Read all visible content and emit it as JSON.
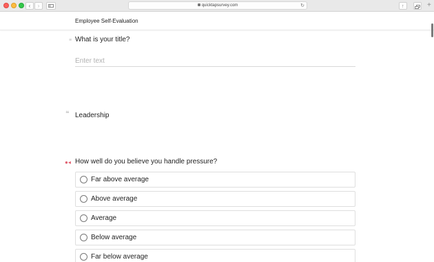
{
  "browser": {
    "url": "quicktapsurvey.com"
  },
  "survey": {
    "title": "Employee Self-Evaluation"
  },
  "questions": [
    {
      "label": "What is your title?",
      "placeholder": "Enter text",
      "value": ""
    },
    {
      "label": "Leadership"
    },
    {
      "label": "How well do you believe you handle pressure?",
      "options": [
        "Far above average",
        "Above average",
        "Average",
        "Below average",
        "Far below average"
      ]
    }
  ],
  "icons": {
    "back": "chevron-left-icon",
    "forward": "chevron-right-icon",
    "sidebar": "sidebar-icon",
    "lock": "lock-icon",
    "reload": "reload-icon",
    "share": "share-icon",
    "tabs": "tabs-icon",
    "new_tab": "plus-icon",
    "text_question": "text-question-icon",
    "section_heading": "quote-icon",
    "rating_question": "rating-question-icon"
  },
  "colors": {
    "traffic_red": "#fc605b",
    "traffic_yellow": "#fdbc40",
    "traffic_green": "#34c84a",
    "required_marker": "#e06070"
  }
}
